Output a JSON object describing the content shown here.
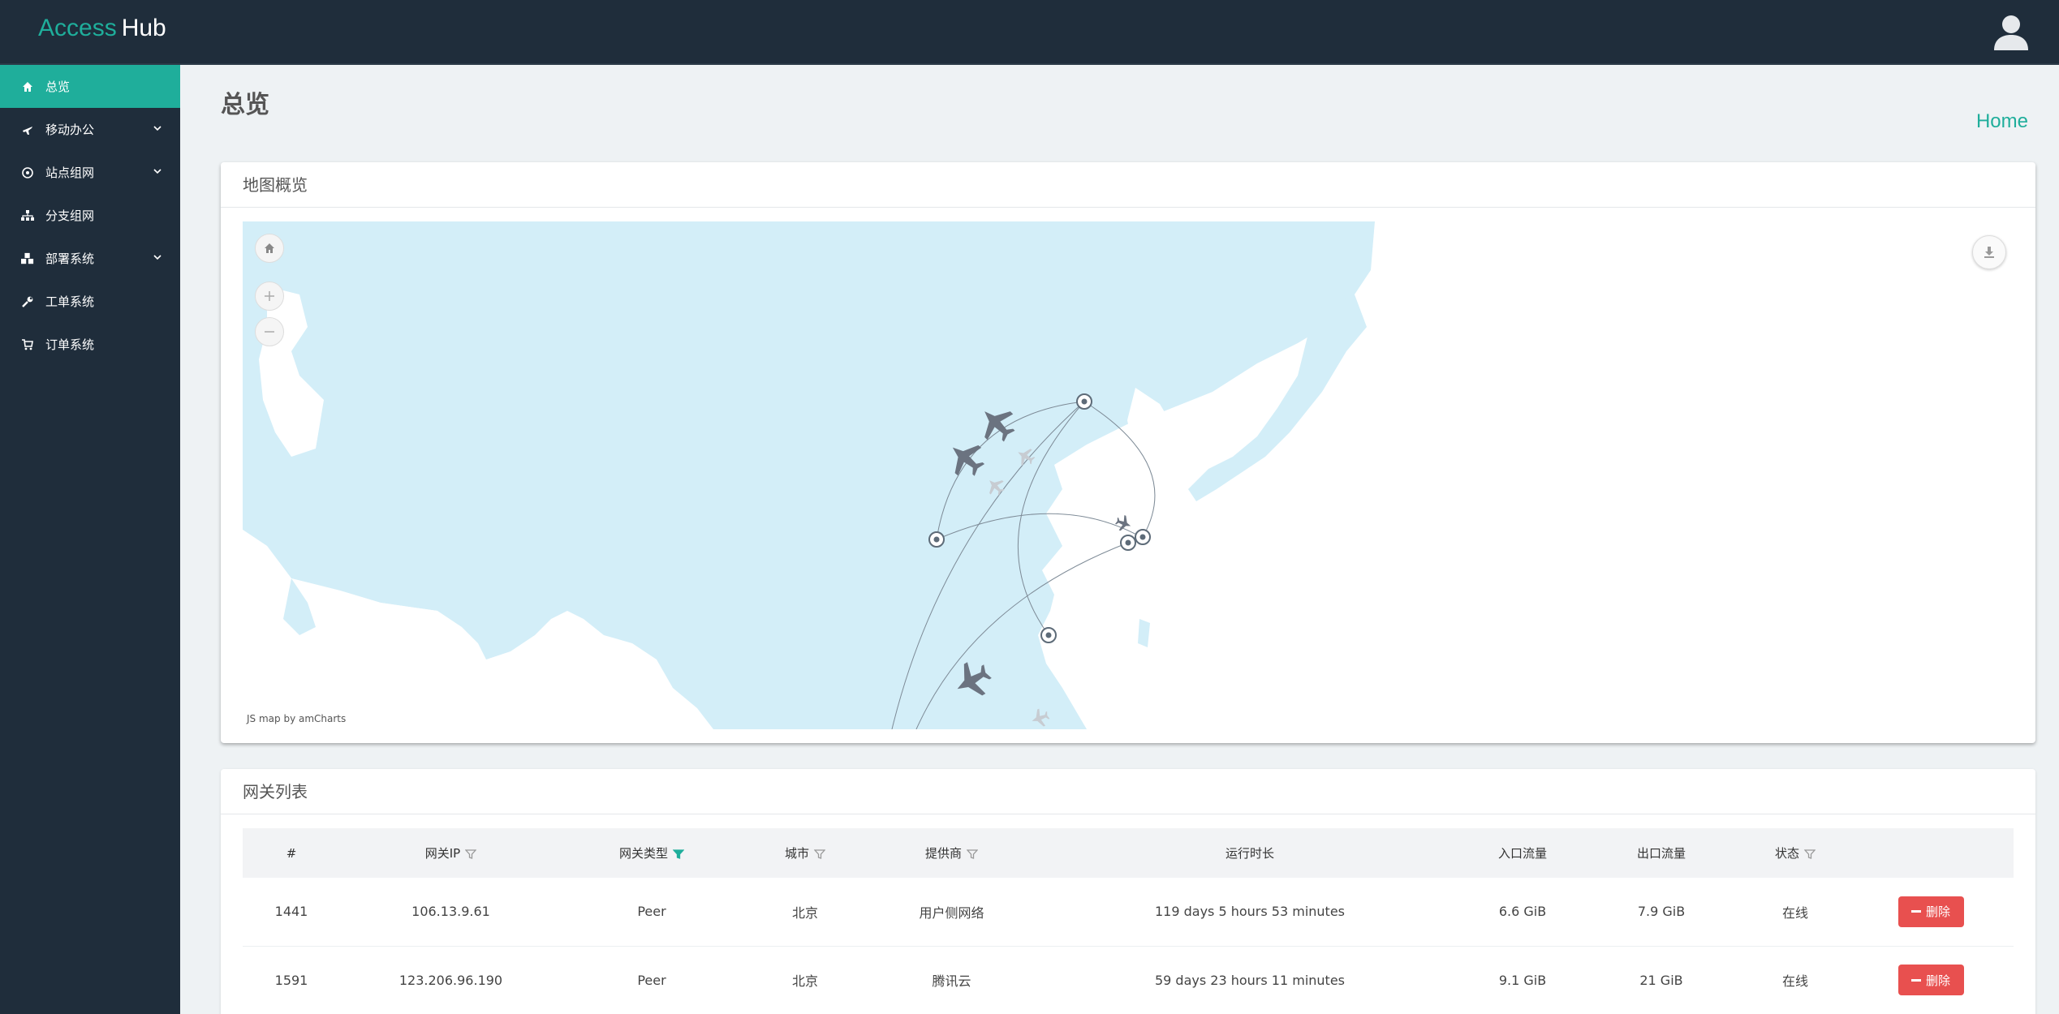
{
  "app": {
    "logo_part1": "Access",
    "logo_part2": "Hub"
  },
  "sidebar": {
    "items": [
      {
        "label": "总览",
        "icon": "home-icon",
        "active": true
      },
      {
        "label": "移动办公",
        "icon": "plane-icon",
        "expandable": true
      },
      {
        "label": "站点组网",
        "icon": "network-icon",
        "expandable": true
      },
      {
        "label": "分支组网",
        "icon": "sitemap-icon"
      },
      {
        "label": "部署系统",
        "icon": "cubes-icon",
        "expandable": true
      },
      {
        "label": "工单系统",
        "icon": "wrench-icon"
      },
      {
        "label": "订单系统",
        "icon": "cart-icon"
      }
    ]
  },
  "page": {
    "title": "总览",
    "breadcrumb": "Home"
  },
  "map_card": {
    "title": "地图概览",
    "credit": "JS map by amCharts"
  },
  "table_card": {
    "title": "网关列表",
    "columns": [
      "#",
      "网关IP",
      "网关类型",
      "城市",
      "提供商",
      "运行时长",
      "入口流量",
      "出口流量",
      "状态",
      ""
    ],
    "filterable_columns": [
      "网关IP",
      "网关类型",
      "城市",
      "提供商",
      "状态"
    ],
    "active_filter_column": "网关类型",
    "rows": [
      {
        "id": "1441",
        "ip": "106.13.9.61",
        "type": "Peer",
        "city": "北京",
        "provider": "用户侧网络",
        "uptime": "119 days 5 hours 53 minutes",
        "in": "6.6 GiB",
        "out": "7.9 GiB",
        "status": "在线",
        "action": "删除"
      },
      {
        "id": "1591",
        "ip": "123.206.96.190",
        "type": "Peer",
        "city": "北京",
        "provider": "腾讯云",
        "uptime": "59 days 23 hours 11 minutes",
        "in": "9.1 GiB",
        "out": "21 GiB",
        "status": "在线",
        "action": "删除"
      }
    ]
  },
  "colors": {
    "accent": "#1fae9b",
    "topbar": "#1f2d3b",
    "danger": "#e8504f",
    "water": "#d3eef8"
  }
}
